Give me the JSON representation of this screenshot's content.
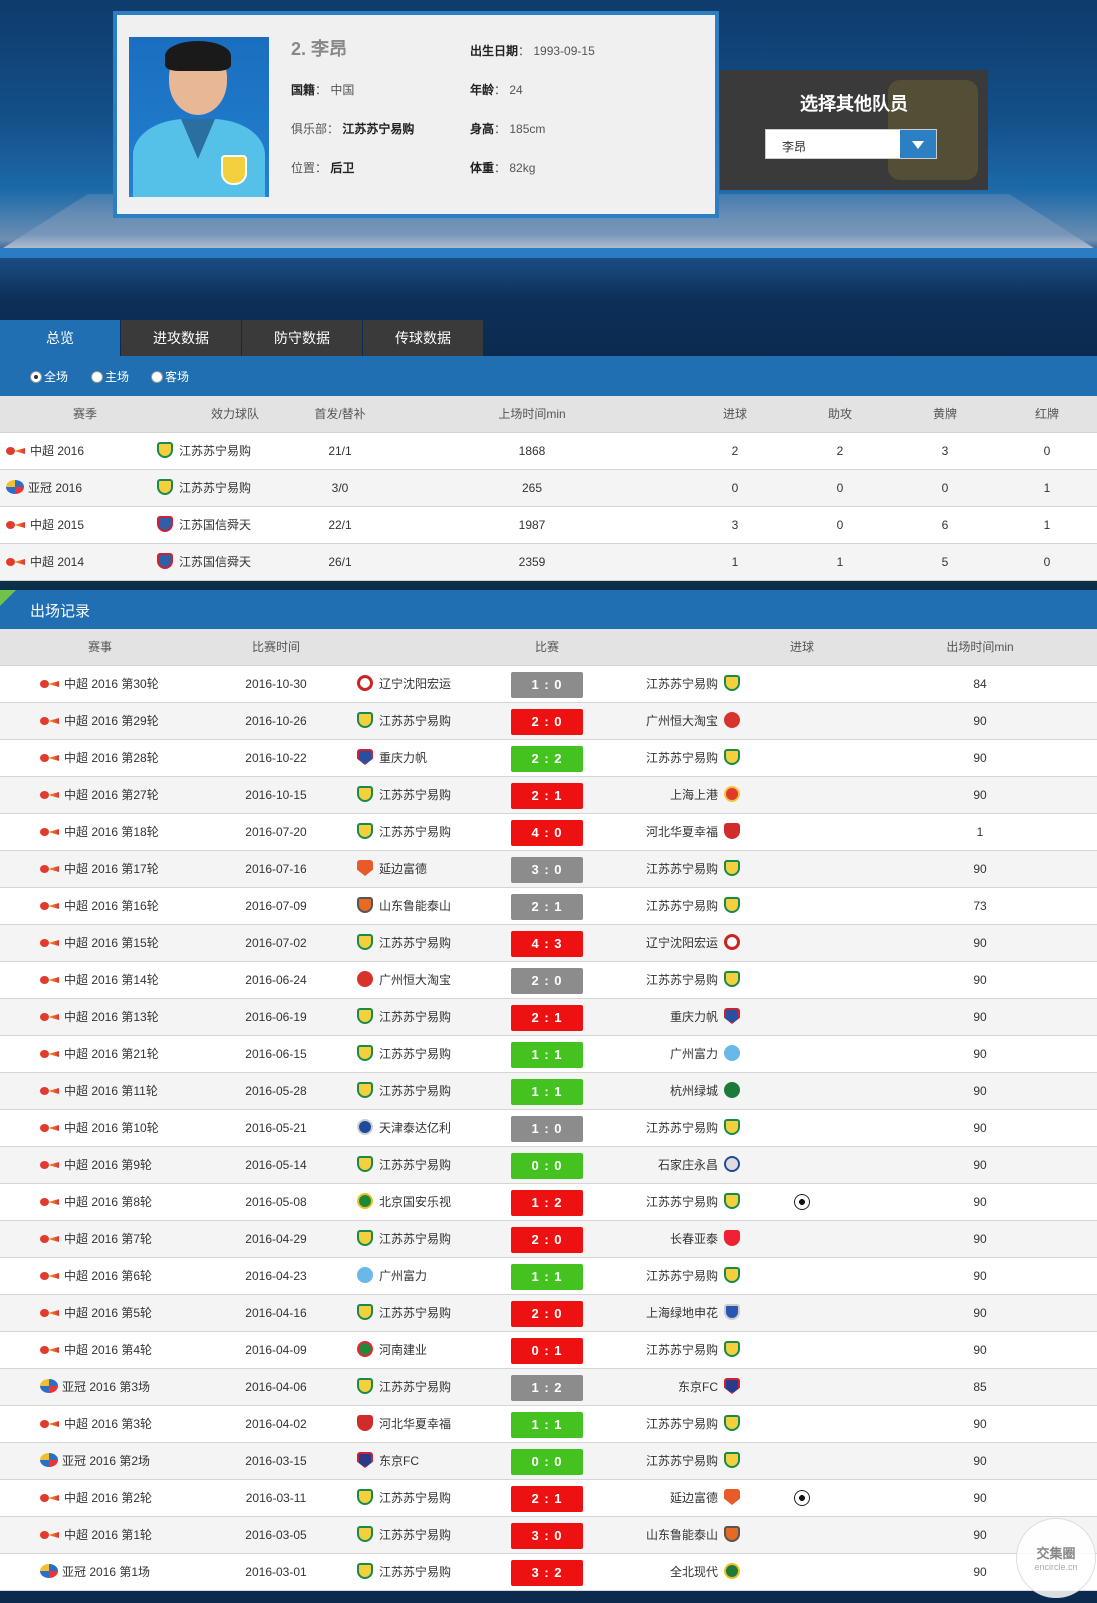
{
  "player": {
    "name": "2. 李昂",
    "birth_label": "出生日期",
    "birth": "1993-09-15",
    "nationality_label": "国籍",
    "nationality": "中国",
    "age_label": "年龄",
    "age": "24",
    "club_label": "俱乐部",
    "club": "江苏苏宁易购",
    "height_label": "身高",
    "height": "185cm",
    "position_label": "位置",
    "position": "后卫",
    "weight_label": "体重",
    "weight": "82kg"
  },
  "selector": {
    "title": "选择其他队员",
    "value": "李昂"
  },
  "tabs": [
    "总览",
    "进攻数据",
    "防守数据",
    "传球数据"
  ],
  "filters": [
    "全场",
    "主场",
    "客场"
  ],
  "season_table": {
    "headers": [
      "赛季",
      "效力球队",
      "首发/替补",
      "上场时间min",
      "进球",
      "助攻",
      "黄牌",
      "红牌"
    ],
    "rows": [
      {
        "comp": "csl",
        "season": "中超 2016",
        "club": "江苏苏宁易购",
        "club_icon": "c-suning",
        "starts": "21/1",
        "minutes": "1868",
        "goals": "2",
        "assists": "2",
        "yellow": "3",
        "red": "0"
      },
      {
        "comp": "acl",
        "season": "亚冠 2016",
        "club": "江苏苏宁易购",
        "club_icon": "c-suning",
        "starts": "3/0",
        "minutes": "265",
        "goals": "0",
        "assists": "0",
        "yellow": "0",
        "red": "1"
      },
      {
        "comp": "csl",
        "season": "中超 2015",
        "club": "江苏国信舜天",
        "club_icon": "c-guoxin",
        "starts": "22/1",
        "minutes": "1987",
        "goals": "3",
        "assists": "0",
        "yellow": "6",
        "red": "1"
      },
      {
        "comp": "csl",
        "season": "中超 2014",
        "club": "江苏国信舜天",
        "club_icon": "c-guoxin",
        "starts": "26/1",
        "minutes": "2359",
        "goals": "1",
        "assists": "1",
        "yellow": "5",
        "red": "0"
      }
    ]
  },
  "records": {
    "title": "出场记录",
    "headers": [
      "赛事",
      "比赛时间",
      "比赛",
      "进球",
      "出场时间min"
    ],
    "rows": [
      {
        "comp": "csl",
        "event": "中超 2016 第30轮",
        "date": "2016-10-30",
        "home": "辽宁沈阳宏运",
        "home_icon": "c-liaoning",
        "score": "1 : 0",
        "color": "grey",
        "away": "江苏苏宁易购",
        "away_icon": "c-suning",
        "goal": false,
        "minutes": "84"
      },
      {
        "comp": "csl",
        "event": "中超 2016 第29轮",
        "date": "2016-10-26",
        "home": "江苏苏宁易购",
        "home_icon": "c-suning",
        "score": "2 : 0",
        "color": "red",
        "away": "广州恒大淘宝",
        "away_icon": "c-evergrande",
        "goal": false,
        "minutes": "90"
      },
      {
        "comp": "csl",
        "event": "中超 2016 第28轮",
        "date": "2016-10-22",
        "home": "重庆力帆",
        "home_icon": "c-lifan",
        "score": "2 : 2",
        "color": "green",
        "away": "江苏苏宁易购",
        "away_icon": "c-suning",
        "goal": false,
        "minutes": "90"
      },
      {
        "comp": "csl",
        "event": "中超 2016 第27轮",
        "date": "2016-10-15",
        "home": "江苏苏宁易购",
        "home_icon": "c-suning",
        "score": "2 : 1",
        "color": "red",
        "away": "上海上港",
        "away_icon": "c-sipg",
        "goal": false,
        "minutes": "90"
      },
      {
        "comp": "csl",
        "event": "中超 2016 第18轮",
        "date": "2016-07-20",
        "home": "江苏苏宁易购",
        "home_icon": "c-suning",
        "score": "4 : 0",
        "color": "red",
        "away": "河北华夏幸福",
        "away_icon": "c-hbcffc",
        "goal": false,
        "minutes": "1"
      },
      {
        "comp": "csl",
        "event": "中超 2016 第17轮",
        "date": "2016-07-16",
        "home": "延边富德",
        "home_icon": "c-yanbian",
        "score": "3 : 0",
        "color": "grey",
        "away": "江苏苏宁易购",
        "away_icon": "c-suning",
        "goal": false,
        "minutes": "90"
      },
      {
        "comp": "csl",
        "event": "中超 2016 第16轮",
        "date": "2016-07-09",
        "home": "山东鲁能泰山",
        "home_icon": "c-luneng",
        "score": "2 : 1",
        "color": "grey",
        "away": "江苏苏宁易购",
        "away_icon": "c-suning",
        "goal": false,
        "minutes": "73"
      },
      {
        "comp": "csl",
        "event": "中超 2016 第15轮",
        "date": "2016-07-02",
        "home": "江苏苏宁易购",
        "home_icon": "c-suning",
        "score": "4 : 3",
        "color": "red",
        "away": "辽宁沈阳宏运",
        "away_icon": "c-liaoning",
        "goal": false,
        "minutes": "90"
      },
      {
        "comp": "csl",
        "event": "中超 2016 第14轮",
        "date": "2016-06-24",
        "home": "广州恒大淘宝",
        "home_icon": "c-evergrande",
        "score": "2 : 0",
        "color": "grey",
        "away": "江苏苏宁易购",
        "away_icon": "c-suning",
        "goal": false,
        "minutes": "90"
      },
      {
        "comp": "csl",
        "event": "中超 2016 第13轮",
        "date": "2016-06-19",
        "home": "江苏苏宁易购",
        "home_icon": "c-suning",
        "score": "2 : 1",
        "color": "red",
        "away": "重庆力帆",
        "away_icon": "c-lifan",
        "goal": false,
        "minutes": "90"
      },
      {
        "comp": "csl",
        "event": "中超 2016 第21轮",
        "date": "2016-06-15",
        "home": "江苏苏宁易购",
        "home_icon": "c-suning",
        "score": "1 : 1",
        "color": "green",
        "away": "广州富力",
        "away_icon": "c-rf",
        "goal": false,
        "minutes": "90"
      },
      {
        "comp": "csl",
        "event": "中超 2016 第11轮",
        "date": "2016-05-28",
        "home": "江苏苏宁易购",
        "home_icon": "c-suning",
        "score": "1 : 1",
        "color": "green",
        "away": "杭州绿城",
        "away_icon": "c-greentown",
        "goal": false,
        "minutes": "90"
      },
      {
        "comp": "csl",
        "event": "中超 2016 第10轮",
        "date": "2016-05-21",
        "home": "天津泰达亿利",
        "home_icon": "c-teda",
        "score": "1 : 0",
        "color": "grey",
        "away": "江苏苏宁易购",
        "away_icon": "c-suning",
        "goal": false,
        "minutes": "90"
      },
      {
        "comp": "csl",
        "event": "中超 2016 第9轮",
        "date": "2016-05-14",
        "home": "江苏苏宁易购",
        "home_icon": "c-suning",
        "score": "0 : 0",
        "color": "green",
        "away": "石家庄永昌",
        "away_icon": "c-yongchang",
        "goal": false,
        "minutes": "90"
      },
      {
        "comp": "csl",
        "event": "中超 2016 第8轮",
        "date": "2016-05-08",
        "home": "北京国安乐视",
        "home_icon": "c-guoan",
        "score": "1 : 2",
        "color": "red",
        "away": "江苏苏宁易购",
        "away_icon": "c-suning",
        "goal": true,
        "minutes": "90"
      },
      {
        "comp": "csl",
        "event": "中超 2016 第7轮",
        "date": "2016-04-29",
        "home": "江苏苏宁易购",
        "home_icon": "c-suning",
        "score": "2 : 0",
        "color": "red",
        "away": "长春亚泰",
        "away_icon": "c-yatai",
        "goal": false,
        "minutes": "90"
      },
      {
        "comp": "csl",
        "event": "中超 2016 第6轮",
        "date": "2016-04-23",
        "home": "广州富力",
        "home_icon": "c-rf",
        "score": "1 : 1",
        "color": "green",
        "away": "江苏苏宁易购",
        "away_icon": "c-suning",
        "goal": false,
        "minutes": "90"
      },
      {
        "comp": "csl",
        "event": "中超 2016 第5轮",
        "date": "2016-04-16",
        "home": "江苏苏宁易购",
        "home_icon": "c-suning",
        "score": "2 : 0",
        "color": "red",
        "away": "上海绿地申花",
        "away_icon": "c-shenhua",
        "goal": false,
        "minutes": "90"
      },
      {
        "comp": "csl",
        "event": "中超 2016 第4轮",
        "date": "2016-04-09",
        "home": "河南建业",
        "home_icon": "c-jianye",
        "score": "0 : 1",
        "color": "red",
        "away": "江苏苏宁易购",
        "away_icon": "c-suning",
        "goal": false,
        "minutes": "90"
      },
      {
        "comp": "acl",
        "event": "亚冠 2016 第3场",
        "date": "2016-04-06",
        "home": "江苏苏宁易购",
        "home_icon": "c-suning",
        "score": "1 : 2",
        "color": "grey",
        "away": "东京FC",
        "away_icon": "c-fctokyo",
        "goal": false,
        "minutes": "85"
      },
      {
        "comp": "csl",
        "event": "中超 2016 第3轮",
        "date": "2016-04-02",
        "home": "河北华夏幸福",
        "home_icon": "c-hbcffc",
        "score": "1 : 1",
        "color": "green",
        "away": "江苏苏宁易购",
        "away_icon": "c-suning",
        "goal": false,
        "minutes": "90"
      },
      {
        "comp": "acl",
        "event": "亚冠 2016 第2场",
        "date": "2016-03-15",
        "home": "东京FC",
        "home_icon": "c-fctokyo",
        "score": "0 : 0",
        "color": "green",
        "away": "江苏苏宁易购",
        "away_icon": "c-suning",
        "goal": false,
        "minutes": "90"
      },
      {
        "comp": "csl",
        "event": "中超 2016 第2轮",
        "date": "2016-03-11",
        "home": "江苏苏宁易购",
        "home_icon": "c-suning",
        "score": "2 : 1",
        "color": "red",
        "away": "延边富德",
        "away_icon": "c-yanbian",
        "goal": true,
        "minutes": "90"
      },
      {
        "comp": "csl",
        "event": "中超 2016 第1轮",
        "date": "2016-03-05",
        "home": "江苏苏宁易购",
        "home_icon": "c-suning",
        "score": "3 : 0",
        "color": "red",
        "away": "山东鲁能泰山",
        "away_icon": "c-luneng",
        "goal": false,
        "minutes": "90"
      },
      {
        "comp": "acl",
        "event": "亚冠 2016 第1场",
        "date": "2016-03-01",
        "home": "江苏苏宁易购",
        "home_icon": "c-suning",
        "score": "3 : 2",
        "color": "red",
        "away": "全北现代",
        "away_icon": "c-jeonbuk",
        "goal": false,
        "minutes": "90"
      }
    ]
  },
  "watermark": {
    "title": "交集圈",
    "sub": "encircle.cn"
  },
  "colors": {
    "accent": "#1f6fb2",
    "win": "#ee1111",
    "draw": "#44c21f",
    "loss": "#8c8c8c"
  }
}
